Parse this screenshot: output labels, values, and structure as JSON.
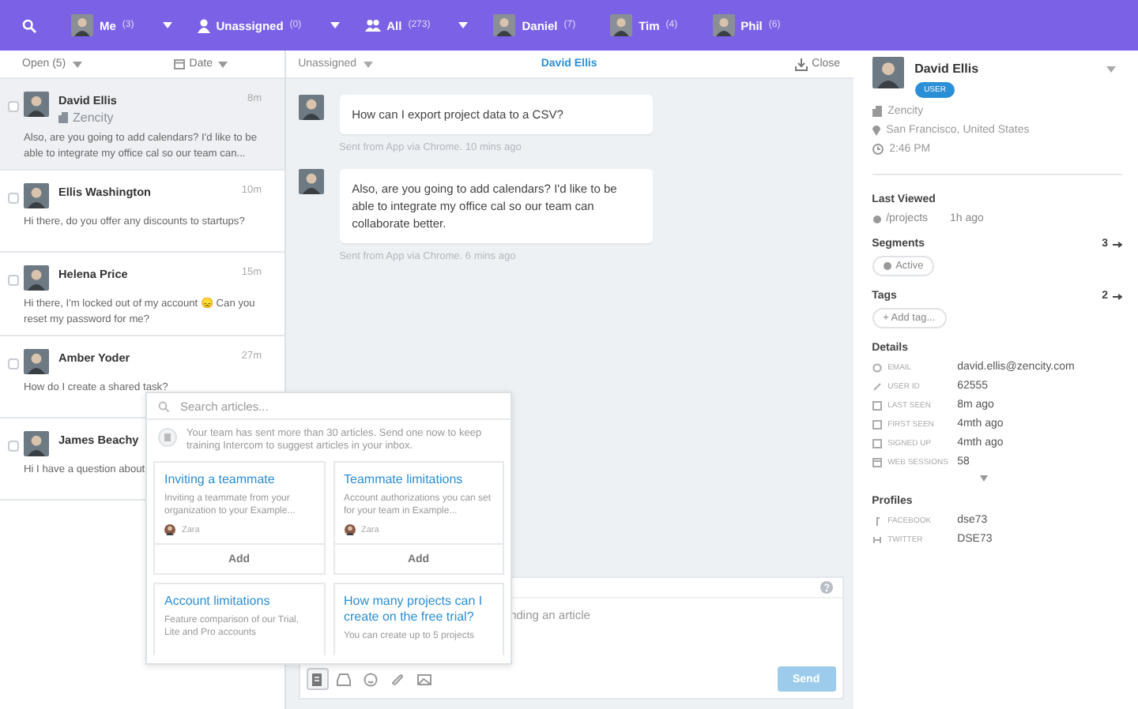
{
  "top_nav": {
    "items": [
      {
        "kind": "avatar",
        "label": "Me",
        "count": "(3)",
        "caret": true
      },
      {
        "kind": "person",
        "label": "Unassigned",
        "count": "(0)",
        "caret": true
      },
      {
        "kind": "people",
        "label": "All",
        "count": "(273)",
        "caret": true
      },
      {
        "kind": "avatar",
        "label": "Daniel",
        "count": "(7)",
        "caret": false
      },
      {
        "kind": "avatar",
        "label": "Tim",
        "count": "(4)",
        "caret": false
      },
      {
        "kind": "avatar",
        "label": "Phil",
        "count": "(6)",
        "caret": false
      }
    ]
  },
  "inbox": {
    "filter": "Open (5)",
    "sort": "Date",
    "conversations": [
      {
        "name": "David Ellis",
        "company": "Zencity",
        "time": "8m",
        "preview": "Also, are you going to add calendars? I'd like to be able to integrate my office cal so our team can...",
        "selected": true,
        "checked": false
      },
      {
        "name": "Ellis Washington",
        "time": "10m",
        "preview": "Hi there, do you offer any discounts to startups?",
        "selected": false,
        "checked": false
      },
      {
        "name": "Helena Price",
        "time": "15m",
        "preview": "Hi there, I'm locked out of my account 😞 Can you reset my password for me?",
        "selected": false,
        "checked": false
      },
      {
        "name": "Amber Yoder",
        "time": "27m",
        "preview": "How do I create a shared task?",
        "selected": false,
        "checked": false
      },
      {
        "name": "James Beachy",
        "preview": "Hi I have a question about",
        "selected": false,
        "checked": false
      }
    ]
  },
  "conversation": {
    "assignee": "Unassigned",
    "title": "David Ellis",
    "close": "Close",
    "messages": [
      {
        "text": "How can I export project data to a CSV?",
        "meta": "Sent from App via Chrome. 10 mins ago"
      },
      {
        "text": "Also, are you going to add calendars? I'd like to be able to integrate my office cal so our team can collaborate better.",
        "meta": "Sent from App via Chrome. 6 mins ago"
      }
    ],
    "composer": {
      "placeholder": "nding an article",
      "send": "Send",
      "tools": [
        {
          "kind": "article",
          "selected": true
        },
        {
          "kind": "reply",
          "selected": false
        },
        {
          "kind": "emoji",
          "selected": false
        },
        {
          "kind": "attach",
          "selected": false
        },
        {
          "kind": "image",
          "selected": false
        }
      ]
    }
  },
  "article_picker": {
    "placeholder": "Search articles...",
    "notice": "Your team has sent more than 30 articles. Send one now to keep training Intercom to suggest articles in your inbox.",
    "articles": [
      {
        "title": "Inviting a teammate",
        "summary": "Inviting a teammate from your organization to your Example...",
        "author": "Zara",
        "action": "Add"
      },
      {
        "title": "Teammate limitations",
        "summary": "Account authorizations you can set for your team in Example...",
        "author": "Zara",
        "action": "Add"
      },
      {
        "title": "Account limitations",
        "summary": "Feature comparison of our Trial, Lite and Pro accounts"
      },
      {
        "title": "How many projects can I create on the free trial?",
        "summary": "You can create up to 5 projects"
      }
    ]
  },
  "user": {
    "name": "David Ellis",
    "role": "USER",
    "company": "Zencity",
    "location": "San Francisco, United States",
    "local_time": "2:46 PM",
    "last_viewed": {
      "title": "Last Viewed",
      "page": "/projects",
      "time": "1h ago"
    },
    "segments": {
      "title": "Segments",
      "count": "3",
      "items": [
        "Active"
      ]
    },
    "tags": {
      "title": "Tags",
      "count": "2",
      "add": "+ Add tag..."
    },
    "details": {
      "title": "Details",
      "rows": [
        {
          "kind": "email",
          "label": "EMAIL",
          "value": "david.ellis@zencity.com"
        },
        {
          "kind": "id",
          "label": "USER ID",
          "value": "62555"
        },
        {
          "kind": "calendar",
          "label": "LAST SEEN",
          "value": "8m ago"
        },
        {
          "kind": "calendar",
          "label": "FIRST SEEN",
          "value": "4mth ago"
        },
        {
          "kind": "calendar",
          "label": "SIGNED UP",
          "value": "4mth ago"
        },
        {
          "kind": "screen",
          "label": "WEB SESSIONS",
          "value": "58"
        }
      ]
    },
    "profiles": {
      "title": "Profiles",
      "rows": [
        {
          "kind": "facebook",
          "label": "FACEBOOK",
          "value": "dse73"
        },
        {
          "kind": "twitter",
          "label": "TWITTER",
          "value": "DSE73"
        }
      ]
    }
  }
}
